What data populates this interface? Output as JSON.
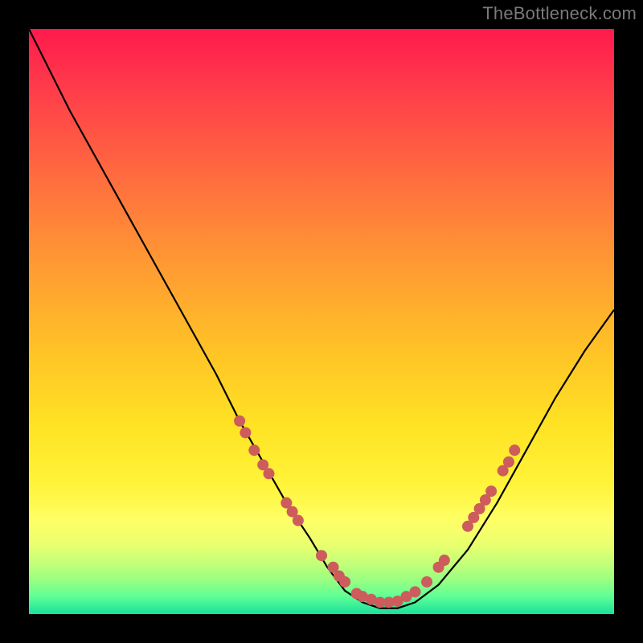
{
  "watermark": "TheBottleneck.com",
  "colors": {
    "background": "#000000",
    "gradient_top": "#ff1a4d",
    "gradient_bottom": "#18e09a",
    "curve_stroke": "#000000",
    "marker_fill": "#cd5c5c",
    "watermark": "#7a7a7a"
  },
  "chart_data": {
    "type": "line",
    "title": "",
    "xlabel": "",
    "ylabel": "",
    "xlim": [
      0,
      100
    ],
    "ylim": [
      0,
      100
    ],
    "grid": false,
    "legend": false,
    "series": [
      {
        "name": "bottleneck-curve",
        "x": [
          0,
          3,
          7,
          12,
          17,
          22,
          27,
          32,
          36,
          40,
          44,
          48,
          51,
          54,
          57,
          60,
          63,
          66,
          70,
          75,
          80,
          85,
          90,
          95,
          100
        ],
        "y": [
          100,
          94,
          86,
          77,
          68,
          59,
          50,
          41,
          33,
          26,
          19,
          13,
          8,
          4,
          2,
          1,
          1,
          2,
          5,
          11,
          19,
          28,
          37,
          45,
          52
        ]
      }
    ],
    "markers": [
      {
        "x": 36,
        "y": 33
      },
      {
        "x": 37,
        "y": 31
      },
      {
        "x": 38.5,
        "y": 28
      },
      {
        "x": 40,
        "y": 25.5
      },
      {
        "x": 41,
        "y": 24
      },
      {
        "x": 44,
        "y": 19
      },
      {
        "x": 45,
        "y": 17.5
      },
      {
        "x": 46,
        "y": 16
      },
      {
        "x": 50,
        "y": 10
      },
      {
        "x": 52,
        "y": 8
      },
      {
        "x": 53,
        "y": 6.5
      },
      {
        "x": 54,
        "y": 5.5
      },
      {
        "x": 56,
        "y": 3.5
      },
      {
        "x": 57,
        "y": 3
      },
      {
        "x": 58.5,
        "y": 2.5
      },
      {
        "x": 60,
        "y": 2
      },
      {
        "x": 61.5,
        "y": 2
      },
      {
        "x": 63,
        "y": 2.2
      },
      {
        "x": 64.5,
        "y": 3
      },
      {
        "x": 66,
        "y": 3.8
      },
      {
        "x": 68,
        "y": 5.5
      },
      {
        "x": 70,
        "y": 8
      },
      {
        "x": 71,
        "y": 9.2
      },
      {
        "x": 75,
        "y": 15
      },
      {
        "x": 76,
        "y": 16.5
      },
      {
        "x": 77,
        "y": 18
      },
      {
        "x": 78,
        "y": 19.5
      },
      {
        "x": 79,
        "y": 21
      },
      {
        "x": 81,
        "y": 24.5
      },
      {
        "x": 82,
        "y": 26
      },
      {
        "x": 83,
        "y": 28
      }
    ],
    "annotations": []
  }
}
